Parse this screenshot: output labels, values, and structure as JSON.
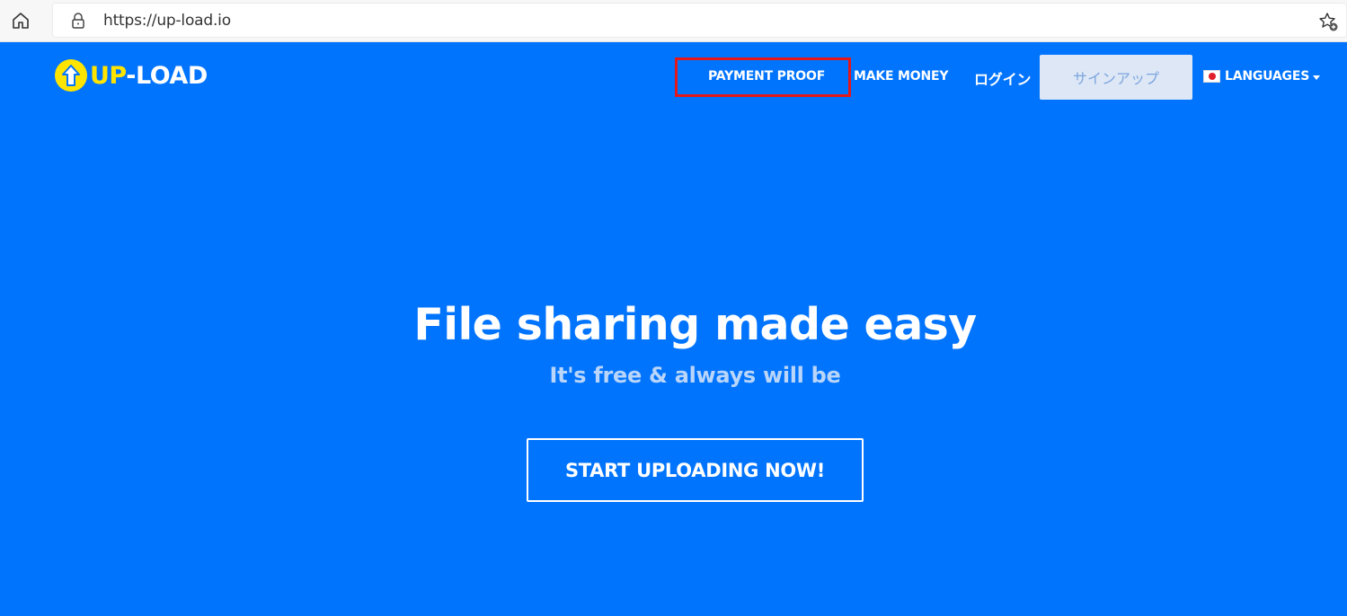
{
  "browser": {
    "url": "https://up-load.io",
    "home_icon": "home-icon",
    "lock_icon": "lock-icon",
    "favorites_icon": "star-add-icon"
  },
  "header": {
    "logo": {
      "up": "UP",
      "load": "-LOAD"
    },
    "nav": {
      "payment_proof": "PAYMENT PROOF",
      "make_money": "MAKE MONEY",
      "login": "ログイン",
      "signup": "サインアップ",
      "languages": "LANGUAGES"
    }
  },
  "hero": {
    "title": "File sharing made easy",
    "subtitle": "It's free & always will be",
    "cta": "START UPLOADING NOW!"
  },
  "colors": {
    "background": "#0174fe",
    "logo_yellow": "#ffe400",
    "highlight": "#e4171a",
    "signup_bg": "#dde7f6",
    "subtitle": "#b9d5f9"
  }
}
